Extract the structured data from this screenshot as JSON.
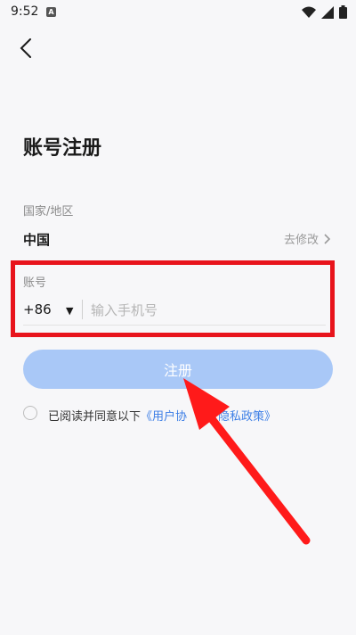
{
  "status_bar": {
    "time": "9:52",
    "notification_letter": "A"
  },
  "page": {
    "title": "账号注册"
  },
  "region": {
    "label": "国家/地区",
    "value": "中国",
    "edit_label": "去修改"
  },
  "account": {
    "label": "账号",
    "country_code": "+86",
    "phone_placeholder": "输入手机号",
    "phone_value": ""
  },
  "register": {
    "button_label": "注册"
  },
  "agreement": {
    "prefix": "已阅读并同意以下",
    "user_agreement": "《用户协",
    "privacy_policy": "《隐私政策》"
  },
  "colors": {
    "highlight_box": "#e8141c",
    "register_button": "#a9c8f7",
    "link": "#3d7fe6",
    "arrow": "#ff1a1a"
  }
}
